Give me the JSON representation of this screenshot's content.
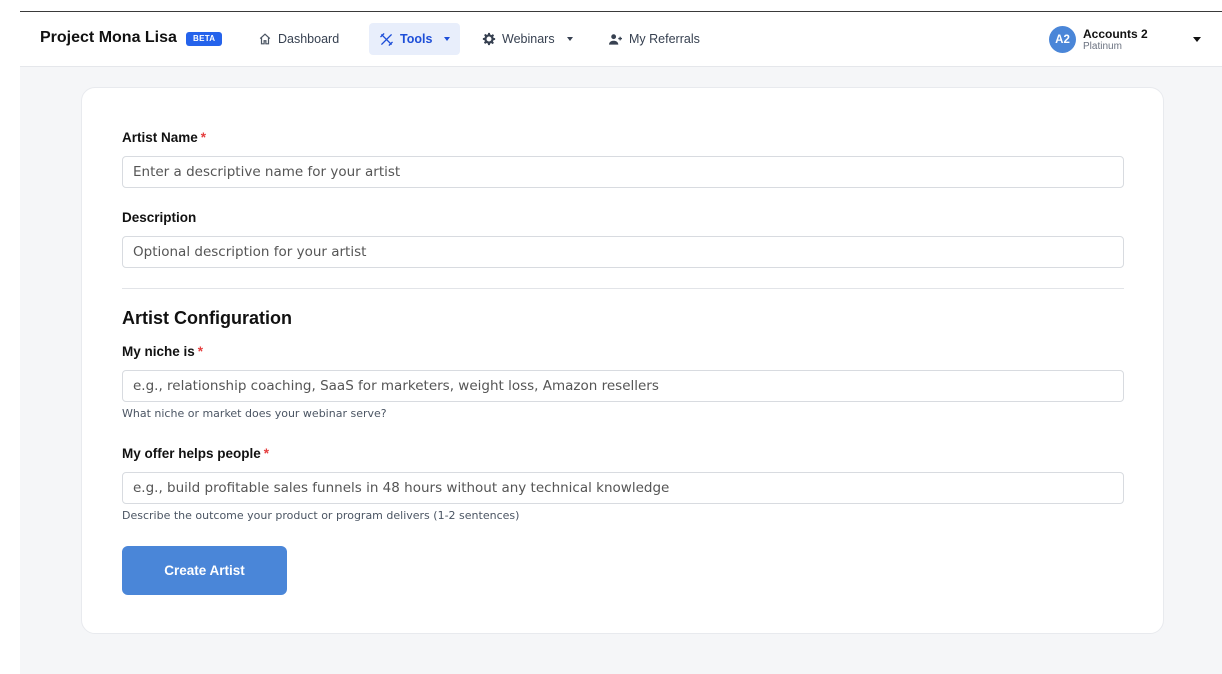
{
  "header": {
    "brand": "Project Mona Lisa",
    "badge": "BETA",
    "nav": [
      {
        "label": "Dashboard",
        "icon": "home-icon"
      },
      {
        "label": "Tools",
        "icon": "tools-icon",
        "active": true
      },
      {
        "label": "Webinars",
        "icon": "gear-icon"
      },
      {
        "label": "My Referrals",
        "icon": "user-plus-icon"
      }
    ],
    "account": {
      "initials": "A2",
      "name": "Accounts 2",
      "tier": "Platinum"
    }
  },
  "form": {
    "artist_name": {
      "label": "Artist Name",
      "required": "*",
      "placeholder": "Enter a descriptive name for your artist",
      "value": ""
    },
    "description": {
      "label": "Description",
      "placeholder": "Optional description for your artist",
      "value": ""
    },
    "section_title": "Artist Configuration",
    "niche": {
      "label": "My niche is",
      "required": "*",
      "placeholder": "e.g., relationship coaching, SaaS for marketers, weight loss, Amazon resellers",
      "hint": "What niche or market does your webinar serve?",
      "value": ""
    },
    "offer": {
      "label": "My offer helps people",
      "required": "*",
      "placeholder": "e.g., build profitable sales funnels in 48 hours without any technical knowledge",
      "hint": "Describe the outcome your product or program delivers (1-2 sentences)",
      "value": ""
    },
    "submit_label": "Create Artist"
  },
  "colors": {
    "accent": "#4a86d8",
    "badge": "#2563eb",
    "required": "#e53e3e"
  }
}
